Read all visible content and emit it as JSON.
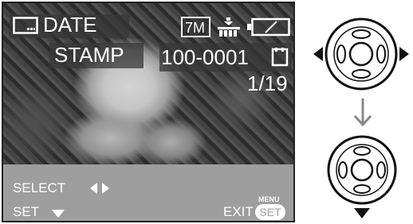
{
  "screen": {
    "mode_title_line1": "DATE",
    "mode_title_line2": "STAMP",
    "picture_size": "7M",
    "file_number": "100-0001",
    "image_counter": "1/19",
    "select_label": "SELECT",
    "set_label": "SET",
    "exit_label": "EXIT",
    "menu_label": "MENU",
    "set_badge_label": "SET"
  },
  "icons": {
    "mode": "date-stamp-mode-icon",
    "quality": "quality-icon",
    "battery": "battery-icon",
    "card": "memory-card-icon",
    "select_arrows": "left-right-arrows-icon",
    "set_arrow": "down-arrow-icon"
  },
  "controls": {
    "step1": "dial-press-left-right",
    "step2": "dial-press-down"
  }
}
